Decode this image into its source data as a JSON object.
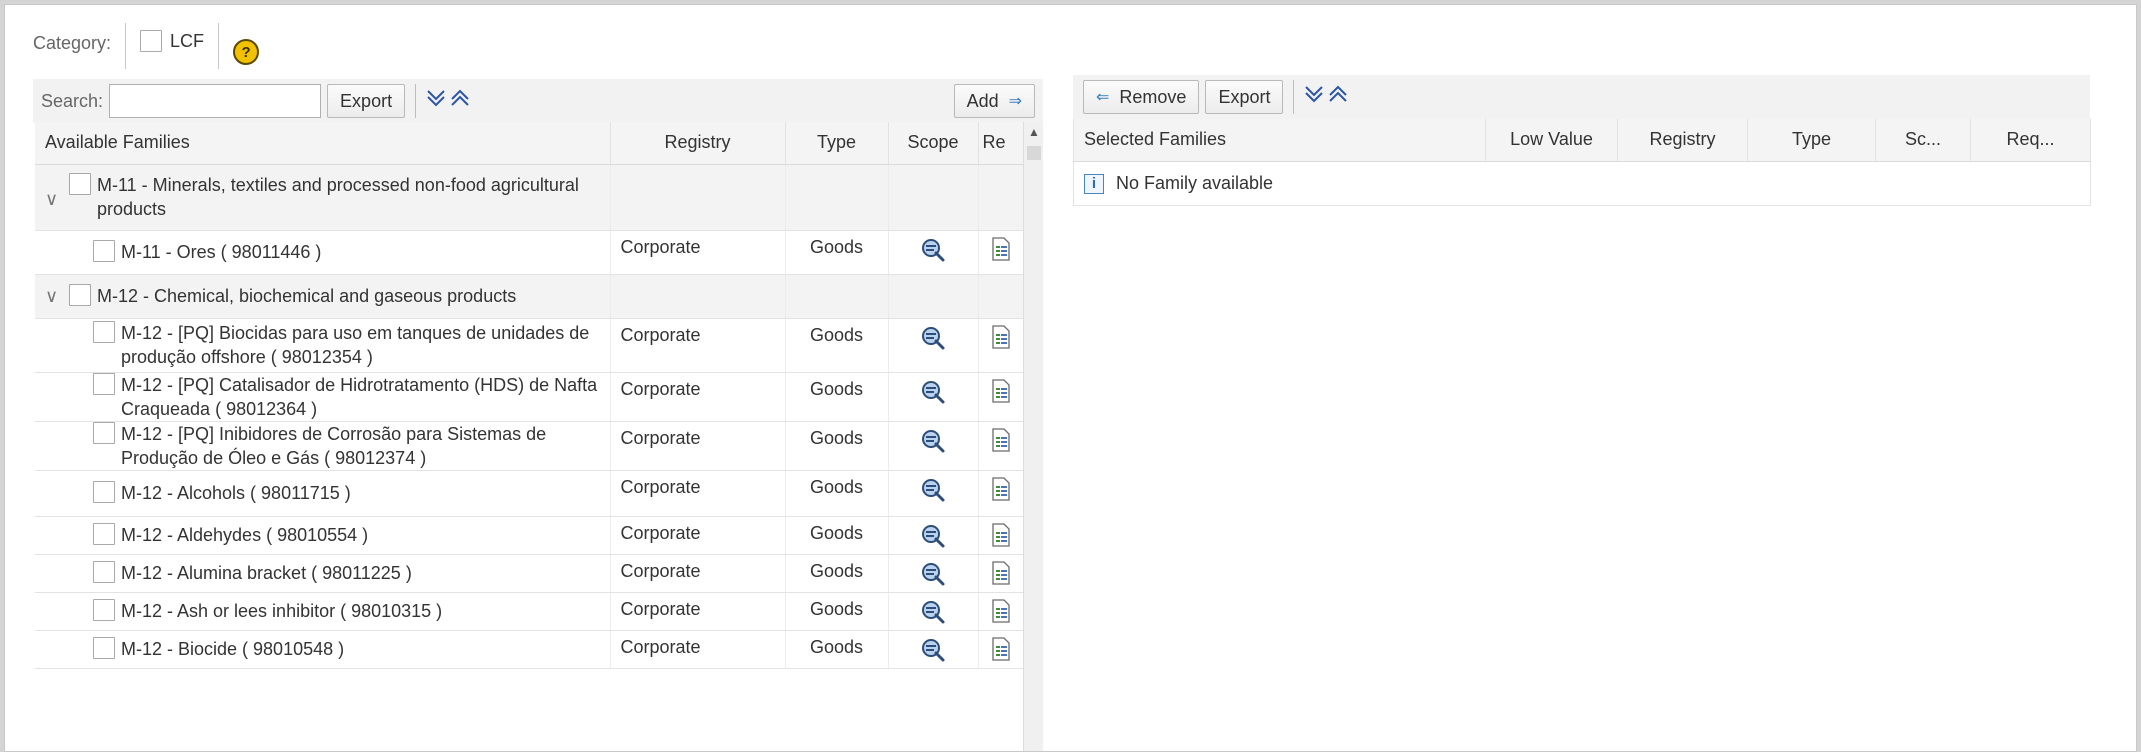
{
  "category": {
    "label": "Category:",
    "lcf_label": "LCF",
    "help_icon": "help-icon"
  },
  "left_toolbar": {
    "search_label": "Search:",
    "search_value": "",
    "export_label": "Export",
    "add_label": "Add"
  },
  "right_toolbar": {
    "remove_label": "Remove",
    "export_label": "Export"
  },
  "available_table": {
    "columns": [
      "Available Families",
      "Registry",
      "Type",
      "Scope",
      "Re"
    ],
    "groups": [
      {
        "name": "M-11 - Minerals, textiles and processed non-food agricultural products",
        "rows": [
          {
            "name": "M-11 - Ores ( 98011446 )",
            "registry": "Corporate",
            "type": "Goods"
          }
        ]
      },
      {
        "name": "M-12 - Chemical, biochemical and gaseous products",
        "rows": [
          {
            "name": "M-12 - [PQ] Biocidas para uso em tanques de unidades de produção offshore ( 98012354 )",
            "registry": "Corporate",
            "type": "Goods"
          },
          {
            "name": "M-12 - [PQ] Catalisador de Hidrotratamento (HDS) de Nafta Craqueada ( 98012364 )",
            "registry": "Corporate",
            "type": "Goods"
          },
          {
            "name": "M-12 - [PQ] Inibidores de Corrosão para Sistemas de Produção de Óleo e Gás ( 98012374 )",
            "registry": "Corporate",
            "type": "Goods"
          },
          {
            "name": "M-12 - Alcohols ( 98011715 )",
            "registry": "Corporate",
            "type": "Goods"
          },
          {
            "name": "M-12 - Aldehydes ( 98010554 )",
            "registry": "Corporate",
            "type": "Goods"
          },
          {
            "name": "M-12 - Alumina bracket ( 98011225 )",
            "registry": "Corporate",
            "type": "Goods"
          },
          {
            "name": "M-12 - Ash or lees inhibitor ( 98010315 )",
            "registry": "Corporate",
            "type": "Goods"
          },
          {
            "name": "M-12 - Biocide ( 98010548 )",
            "registry": "Corporate",
            "type": "Goods"
          }
        ]
      }
    ]
  },
  "selected_table": {
    "columns": [
      "Selected Families",
      "Low Value",
      "Registry",
      "Type",
      "Sc...",
      "Req..."
    ],
    "empty_message": "No Family available"
  }
}
